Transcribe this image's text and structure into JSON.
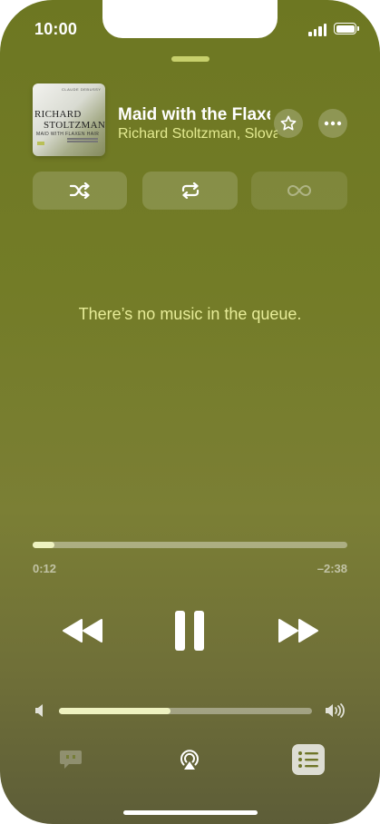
{
  "status_bar": {
    "time": "10:00"
  },
  "now_playing": {
    "title": "Maid with the Flaxen Hair",
    "artist": "Richard Stoltzman, Slovak Radio Symphony Orchestra",
    "artwork": {
      "top_text": "CLAUDE DEBUSSY",
      "name_line1": "RICHARD",
      "name_line2": "STOLTZMAN",
      "subtitle": "MAID WITH FLAXEN HAIR"
    },
    "actions": [
      {
        "name": "favorite",
        "icon": "star-icon"
      },
      {
        "name": "more",
        "icon": "ellipsis-icon"
      }
    ]
  },
  "playback_modes": [
    {
      "name": "shuffle",
      "icon": "shuffle-icon",
      "enabled": true
    },
    {
      "name": "repeat",
      "icon": "repeat-icon",
      "enabled": true
    },
    {
      "name": "autoplay",
      "icon": "infinity-icon",
      "enabled": false
    }
  ],
  "queue": {
    "empty_message": "There’s no music in the queue."
  },
  "progress": {
    "elapsed": "0:12",
    "remaining": "–2:38",
    "fraction": 0.07
  },
  "transport": {
    "previous_icon": "rewind-icon",
    "play_pause_icon": "pause-icon",
    "next_icon": "fast-forward-icon"
  },
  "volume": {
    "level": 0.44
  },
  "bottom_bar": [
    {
      "name": "lyrics",
      "icon": "lyrics-bubble-icon",
      "active": false
    },
    {
      "name": "airplay",
      "icon": "airplay-icon",
      "active": false
    },
    {
      "name": "queue",
      "icon": "list-icon",
      "active": true
    }
  ],
  "colors": {
    "background": "#737c27",
    "accent_text": "#e3ea90",
    "grabber": "#c7d06c"
  }
}
